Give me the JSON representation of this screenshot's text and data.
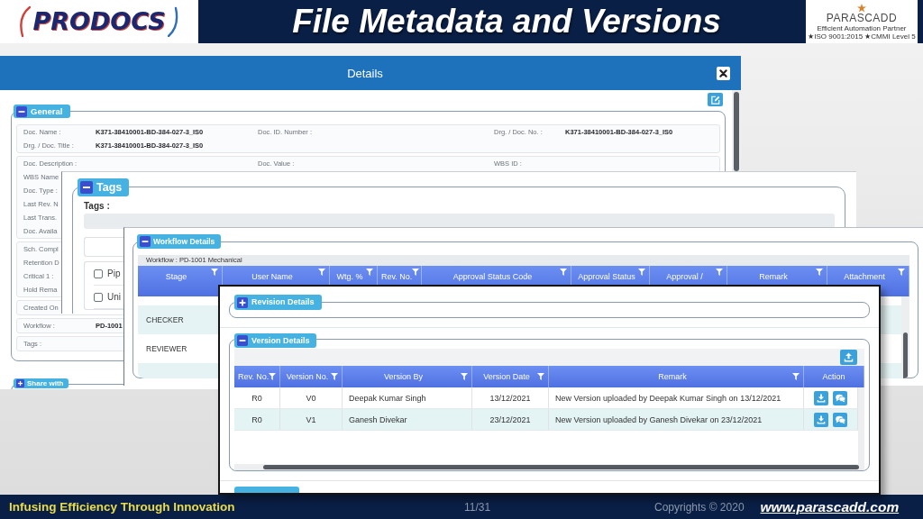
{
  "header": {
    "title": "File Metadata and Versions",
    "left_logo": {
      "wordmark": "PRODOCS"
    },
    "right_logo": {
      "name": "PARASCADD",
      "tagline": "Efficient Automation Partner",
      "certifications": "★ISO 9001:2015 ★CMMI Level 5"
    }
  },
  "details_window": {
    "title": "Details",
    "general": {
      "legend": "General",
      "expanded": true,
      "groups": [
        {
          "rows": [
            {
              "fields": [
                {
                  "label": "Doc. Name :",
                  "value": "K371-38410001-BD-384-027-3_IS0"
                },
                {
                  "label": "Doc. ID. Number :"
                },
                {
                  "label": "Drg. / Doc. No. :",
                  "value": "K371-38410001-BD-384-027-3_IS0"
                }
              ]
            },
            {
              "fields": [
                {
                  "label": "Drg. / Doc. Title :",
                  "value": "K371-38410001-BD-384-027-3_IS0"
                }
              ]
            }
          ]
        },
        {
          "rows": [
            {
              "fields": [
                {
                  "label": "Doc. Description :"
                },
                {
                  "label": "Doc. Value :"
                },
                {
                  "label": "WBS ID :"
                }
              ]
            },
            {
              "fields": [
                {
                  "label": "WBS Name"
                }
              ]
            },
            {
              "fields": [
                {
                  "label": "Doc. Type :"
                }
              ]
            },
            {
              "fields": [
                {
                  "label": "Last Rev. N"
                }
              ]
            },
            {
              "fields": [
                {
                  "label": "Last Trans."
                }
              ]
            },
            {
              "fields": [
                {
                  "label": "Doc. Availa"
                }
              ]
            }
          ]
        },
        {
          "rows": [
            {
              "fields": [
                {
                  "label": "Sch. Compl"
                }
              ]
            },
            {
              "fields": [
                {
                  "label": "Retention D"
                }
              ]
            },
            {
              "fields": [
                {
                  "label": "Critical 1 :"
                }
              ]
            },
            {
              "fields": [
                {
                  "label": "Hold Rema"
                }
              ]
            }
          ]
        },
        {
          "rows": [
            {
              "fields": [
                {
                  "label": "Created On"
                }
              ]
            }
          ]
        },
        {
          "rows": [
            {
              "fields": [
                {
                  "label": "Workflow :",
                  "value": "PD-1001"
                }
              ]
            }
          ]
        },
        {
          "rows": [
            {
              "fields": [
                {
                  "label": "Tags :"
                }
              ]
            }
          ]
        }
      ]
    },
    "share_with": {
      "legend": "Share with",
      "expanded": false
    }
  },
  "tags_window": {
    "legend": "Tags",
    "expanded": true,
    "label": "Tags :",
    "options": [
      {
        "label": "Pip",
        "checked": false
      },
      {
        "label": "Uni",
        "checked": false
      }
    ]
  },
  "workflow_window": {
    "legend": "Workflow Details",
    "expanded": true,
    "workflow": "Workflow : PD-1001 Mechanical",
    "columns": [
      {
        "label": "Stage",
        "filter": true
      },
      {
        "label": "User Name",
        "filter": true
      },
      {
        "label": "Wtg. %",
        "filter": true
      },
      {
        "label": "Rev. No.",
        "filter": true
      },
      {
        "label": "Approval Status Code",
        "filter": true
      },
      {
        "label": "Approval Status",
        "filter": true
      },
      {
        "label": "Approval /",
        "filter": true
      },
      {
        "label": "Remark",
        "filter": true
      },
      {
        "label": "Attachment",
        "filter": true
      }
    ],
    "rows": [
      {
        "stage": "CHECKER"
      },
      {
        "stage": "REVIEWER"
      }
    ]
  },
  "versions_window": {
    "revision_details": {
      "legend": "Revision Details",
      "expanded": false
    },
    "version_details": {
      "legend": "Version Details",
      "expanded": true,
      "columns": [
        {
          "label": "Rev. No.",
          "filter": true
        },
        {
          "label": "Version No.",
          "filter": true
        },
        {
          "label": "Version By",
          "filter": true
        },
        {
          "label": "Version Date",
          "filter": true
        },
        {
          "label": "Remark",
          "filter": true
        },
        {
          "label": "Action",
          "filter": false
        }
      ],
      "rows": [
        {
          "rev_no": "R0",
          "version_no": "V0",
          "version_by": "Deepak Kumar Singh",
          "version_date": "13/12/2021",
          "remark": "New Version uploaded by Deepak Kumar Singh on 13/12/2021"
        },
        {
          "rev_no": "R0",
          "version_no": "V1",
          "version_by": "Ganesh Divekar",
          "version_date": "23/12/2021",
          "remark": "New Version uploaded by Ganesh Divekar on 23/12/2021"
        }
      ]
    }
  },
  "footer": {
    "tagline": "Infusing Efficiency Through Innovation",
    "page": "11/31",
    "copyright": "Copyrights © 2020",
    "website": "www.parascadd.com"
  }
}
